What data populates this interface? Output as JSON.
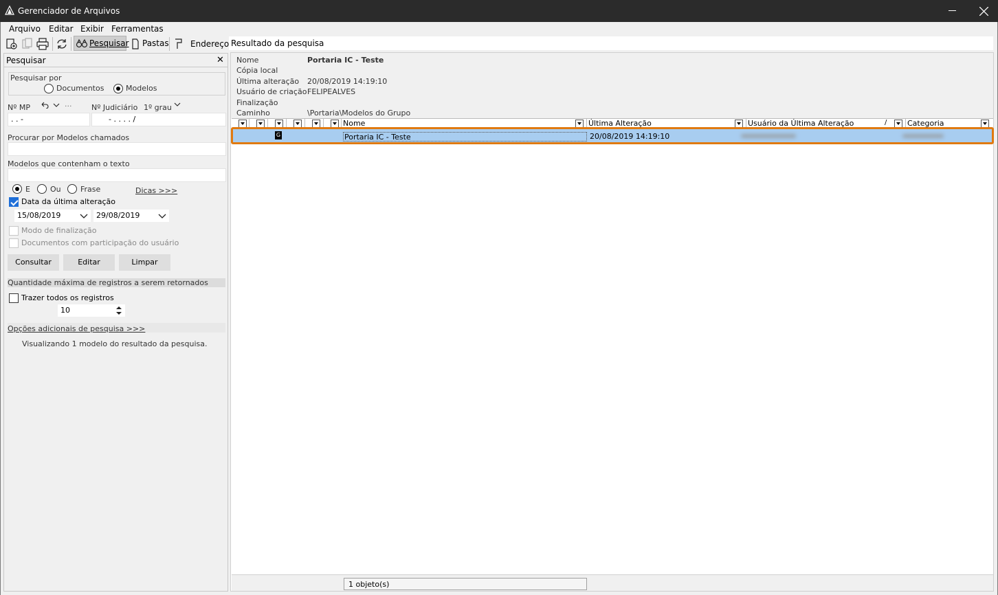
{
  "window": {
    "title": "Gerenciador de Arquivos"
  },
  "menu": [
    "Arquivo",
    "Editar",
    "Exibir",
    "Ferramentas"
  ],
  "toolbar": {
    "search_label": "Pesquisar",
    "folders_label": "Pastas",
    "address_label": "Endereço",
    "address_value": "Resultado da pesquisa"
  },
  "search_panel": {
    "title": "Pesquisar",
    "search_by_label": "Pesquisar por",
    "option_documents": "Documentos",
    "option_models": "Modelos",
    "mp_label": "Nº MP",
    "mp_value": ". .     -",
    "mp_dots": "···",
    "judicial_label": "Nº Judiciário",
    "judicial_degree": "1º grau",
    "judicial_value": "-  .  . . .      /",
    "models_named_label": "Procurar por Modelos chamados",
    "models_named_value": "",
    "contain_text_label": "Modelos que contenham o texto",
    "contain_text_value": "",
    "logic_and": "E",
    "logic_or": "Ou",
    "logic_phrase": "Frase",
    "tips_link": "Dicas >>>",
    "last_change_label": "Data da última alteração",
    "date_from": "15/08/2019",
    "date_to": "29/08/2019",
    "finalization_label": "Modo de finalização",
    "participation_label": "Documentos com participação do usuário",
    "btn_query": "Consultar",
    "btn_edit": "Editar",
    "btn_clear": "Limpar",
    "max_records_label": "Quantidade máxima de registros a serem retornados",
    "bring_all_label": "Trazer todos os registros",
    "max_records_value": "10",
    "more_options_link": "Opções adicionais de pesquisa >>>",
    "result_message": "Visualizando 1 modelo do resultado da pesquisa."
  },
  "details": {
    "name_label": "Nome",
    "name_value": "Portaria IC - Teste",
    "local_copy_label": "Cópia local",
    "last_change_label": "Última alteração",
    "last_change_value": "20/08/2019 14:19:10",
    "created_by_label": "Usuário de criação",
    "created_by_value": "FELIPEALVES",
    "finalization_label": "Finalização",
    "path_label": "Caminho",
    "path_value": "\\Portaria\\Modelos do Grupo"
  },
  "grid": {
    "columns": [
      "Nome",
      "Última Alteração",
      "Usuário da Última Alteração",
      "Categoria"
    ],
    "sort_indicator": "/",
    "rows": [
      {
        "badge": "G",
        "name": "Portaria IC - Teste",
        "last_change": "20/08/2019 14:19:10"
      }
    ]
  },
  "status": {
    "count": "1 objeto(s)"
  },
  "colors": {
    "highlight": "#e07a10",
    "selection": "#a8cdf0",
    "titlebar": "#2b2b2b"
  }
}
